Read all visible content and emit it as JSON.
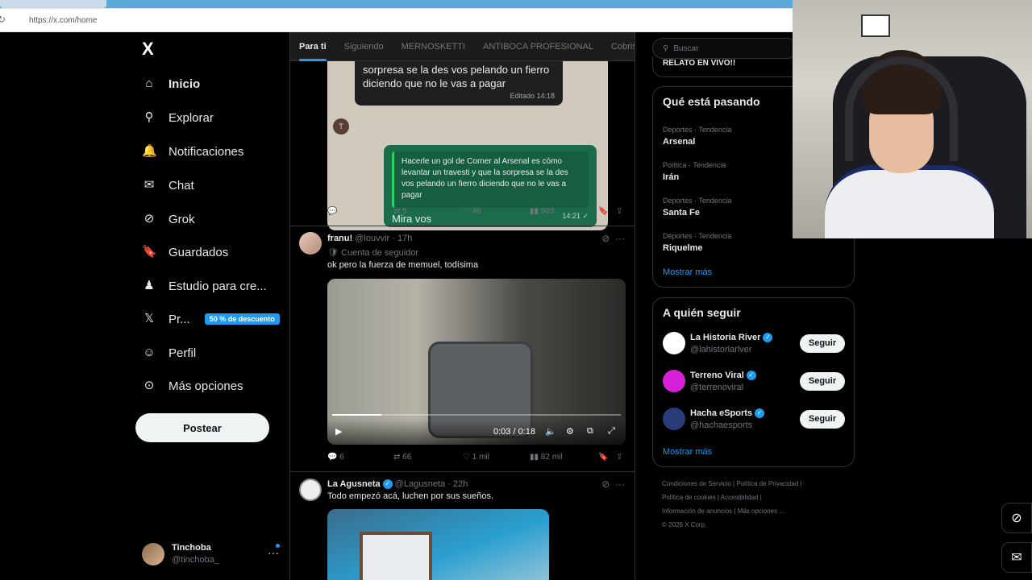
{
  "browser": {
    "url": "https://x.com/home"
  },
  "sidebar": {
    "logo": "X",
    "items": [
      {
        "icon": "home-icon",
        "glyph": "⌂",
        "label": "Inicio",
        "bold": true
      },
      {
        "icon": "search-icon",
        "glyph": "⚲",
        "label": "Explorar"
      },
      {
        "icon": "bell-icon",
        "glyph": "🔔",
        "label": "Notificaciones"
      },
      {
        "icon": "mail-icon",
        "glyph": "✉",
        "label": "Chat"
      },
      {
        "icon": "grok-icon",
        "glyph": "⊘",
        "label": "Grok"
      },
      {
        "icon": "bookmark-icon",
        "glyph": "🔖",
        "label": "Guardados"
      },
      {
        "icon": "creator-studio-icon",
        "glyph": "♟",
        "label": "Estudio para cre..."
      },
      {
        "icon": "x-premium-icon",
        "glyph": "𝕏",
        "label": "Pr..."
      },
      {
        "icon": "profile-icon",
        "glyph": "☺",
        "label": "Perfil"
      },
      {
        "icon": "more-options-icon",
        "glyph": "⊙",
        "label": "Más opciones"
      }
    ],
    "premium_badge": "50 % de descuento",
    "post_button": "Postear",
    "account": {
      "name": "Tinchoba",
      "handle": "@tinchoba_",
      "more": "···"
    }
  },
  "feed": {
    "tabs": [
      "Para ti",
      "Siguiendo",
      "MERNOSKETTI",
      "ANTIBOCA PROFESIONAL",
      "Cobris"
    ],
    "chat_image": {
      "incoming": "sorpresa se la des vos pelando un fierro diciendo que no le vas a pagar",
      "incoming_time": "Editado 14:18",
      "avatar_letter": "T",
      "quote": "Hacerle un gol de Corner al Arsenal es cómo levantar un travesti y que la sorpresa se la des vos pelando un fierro diciendo que no le vas a pagar",
      "message": "Mira vos",
      "message_time": "14:21 ✓"
    },
    "tweet1_actions": {
      "replies": "",
      "reposts": "5",
      "likes": "46",
      "views": "903"
    },
    "tweet2": {
      "name": "franu!",
      "meta": "@louvvir · 17h",
      "badge": "🛡 Cuenta de seguidor",
      "text": "ok pero la fuerza de memuel, todísima",
      "video_time": "0:03 / 0:18",
      "progress": 0.17,
      "actions": {
        "replies": "6",
        "reposts": "66",
        "likes": "1 mil",
        "views": "82 mil"
      }
    },
    "tweet3": {
      "name": "La Agusneta",
      "meta": "@Lagusneta · 22h",
      "text": "Todo empezó acá, luchen por sus sueños."
    }
  },
  "right": {
    "search_placeholder": "Buscar",
    "top_banner": "RELATO EN VIVO!!",
    "trends_title": "Qué está pasando",
    "trends": [
      {
        "category": "Deportes · Tendencia",
        "name": "Arsenal"
      },
      {
        "category": "Política · Tendencia",
        "name": "Irán"
      },
      {
        "category": "Deportes · Tendencia",
        "name": "Santa Fe"
      },
      {
        "category": "Deportes · Tendencia",
        "name": "Riquelme"
      }
    ],
    "show_more": "Mostrar más",
    "follow_title": "A quién seguir",
    "follow": [
      {
        "name": "La Historia River",
        "handle": "@lahistorlarlver",
        "button": "Seguir",
        "color": "#ffffff"
      },
      {
        "name": "Terreno Viral",
        "handle": "@terrenoviral",
        "button": "Seguir",
        "color": "#d61fd6"
      },
      {
        "name": "Hacha eSports",
        "handle": "@hachaesports",
        "button": "Seguir",
        "color": "#2a3b7a"
      }
    ],
    "footer": [
      "Condiciones de Servicio  |  Política de Privacidad  |",
      "Política de cookies  |  Accesibilidad  |",
      "Información de anuncios  |  Más opciones ...",
      "© 2026 X Corp."
    ]
  }
}
